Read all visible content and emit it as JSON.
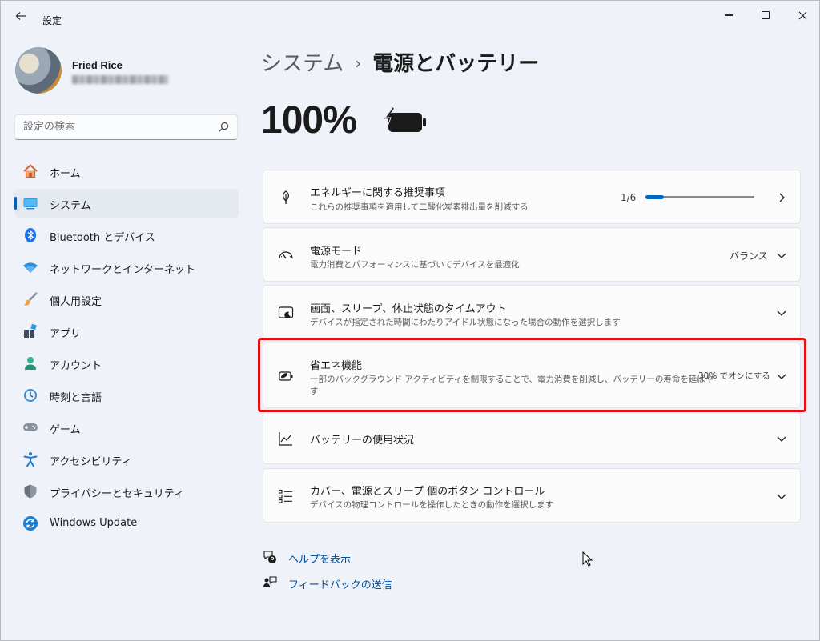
{
  "window": {
    "title": "設定",
    "back_icon": "back-arrow-icon",
    "controls": [
      "minimize-icon",
      "maximize-icon",
      "close-icon"
    ]
  },
  "profile": {
    "name": "Fried Rice"
  },
  "search": {
    "placeholder": "設定の検索",
    "icon": "search-icon"
  },
  "sidebar": {
    "items": [
      {
        "label": "ホーム",
        "icon": "home-icon",
        "active": false
      },
      {
        "label": "システム",
        "icon": "system-icon",
        "active": true
      },
      {
        "label": "Bluetooth とデバイス",
        "icon": "bluetooth-icon",
        "active": false
      },
      {
        "label": "ネットワークとインターネット",
        "icon": "wifi-icon",
        "active": false
      },
      {
        "label": "個人用設定",
        "icon": "brush-icon",
        "active": false
      },
      {
        "label": "アプリ",
        "icon": "apps-icon",
        "active": false
      },
      {
        "label": "アカウント",
        "icon": "account-icon",
        "active": false
      },
      {
        "label": "時刻と言語",
        "icon": "time-language-icon",
        "active": false
      },
      {
        "label": "ゲーム",
        "icon": "gamepad-icon",
        "active": false
      },
      {
        "label": "アクセシビリティ",
        "icon": "accessibility-icon",
        "active": false
      },
      {
        "label": "プライバシーとセキュリティ",
        "icon": "shield-icon",
        "active": false
      },
      {
        "label": "Windows Update",
        "icon": "windows-update-icon",
        "active": false
      }
    ]
  },
  "header": {
    "parent": "システム",
    "separator": "›",
    "current": "電源とバッテリー"
  },
  "battery": {
    "percent_text": "100%",
    "icon": "battery-charging-icon"
  },
  "cards": [
    {
      "title": "エネルギーに関する推奨事項",
      "subtitle": "これらの推奨事項を適用して二酸化炭素排出量を削減する",
      "value": "1/6",
      "progress": 0.1667,
      "icon": "leaf-icon",
      "chevron": "chevron-right-icon"
    },
    {
      "title": "電源モード",
      "subtitle": "電力消費とパフォーマンスに基づいてデバイスを最適化",
      "value": "バランス",
      "icon": "gauge-icon",
      "chevron": "chevron-down-icon"
    },
    {
      "title": "画面、スリープ、休止状態のタイムアウト",
      "subtitle": "デバイスが指定された時間にわたりアイドル状態になった場合の動作を選択します",
      "icon": "screen-sleep-icon",
      "chevron": "chevron-down-icon"
    },
    {
      "title": "省エネ機能",
      "subtitle_line1": "一部のバックグラウンド アクティビティを制限することで、電力消費を削減し、バッテリーの寿命を延ばす",
      "subtitle_line2": "す",
      "subtitle_line1_visible": "一部のバックグラウンド アクティビティを制限することで、電力消費を削減し、バッテリーの寿命を延ばや",
      "value": "30% でオンにする",
      "icon": "energy-saver-icon",
      "chevron": "chevron-down-icon"
    },
    {
      "title": "バッテリーの使用状況",
      "icon": "usage-chart-icon",
      "chevron": "chevron-down-icon"
    },
    {
      "title": "カバー、電源とスリープ 個のボタン コントロール",
      "subtitle": "デバイスの物理コントロールを操作したときの動作を選択します",
      "icon": "buttons-list-icon",
      "chevron": "chevron-down-icon"
    }
  ],
  "links": {
    "help": "ヘルプを表示",
    "feedback": "フィードバックの送信"
  },
  "colors": {
    "accent": "#0067c0",
    "highlight_border": "#e80f10",
    "background": "#eff3f9"
  }
}
